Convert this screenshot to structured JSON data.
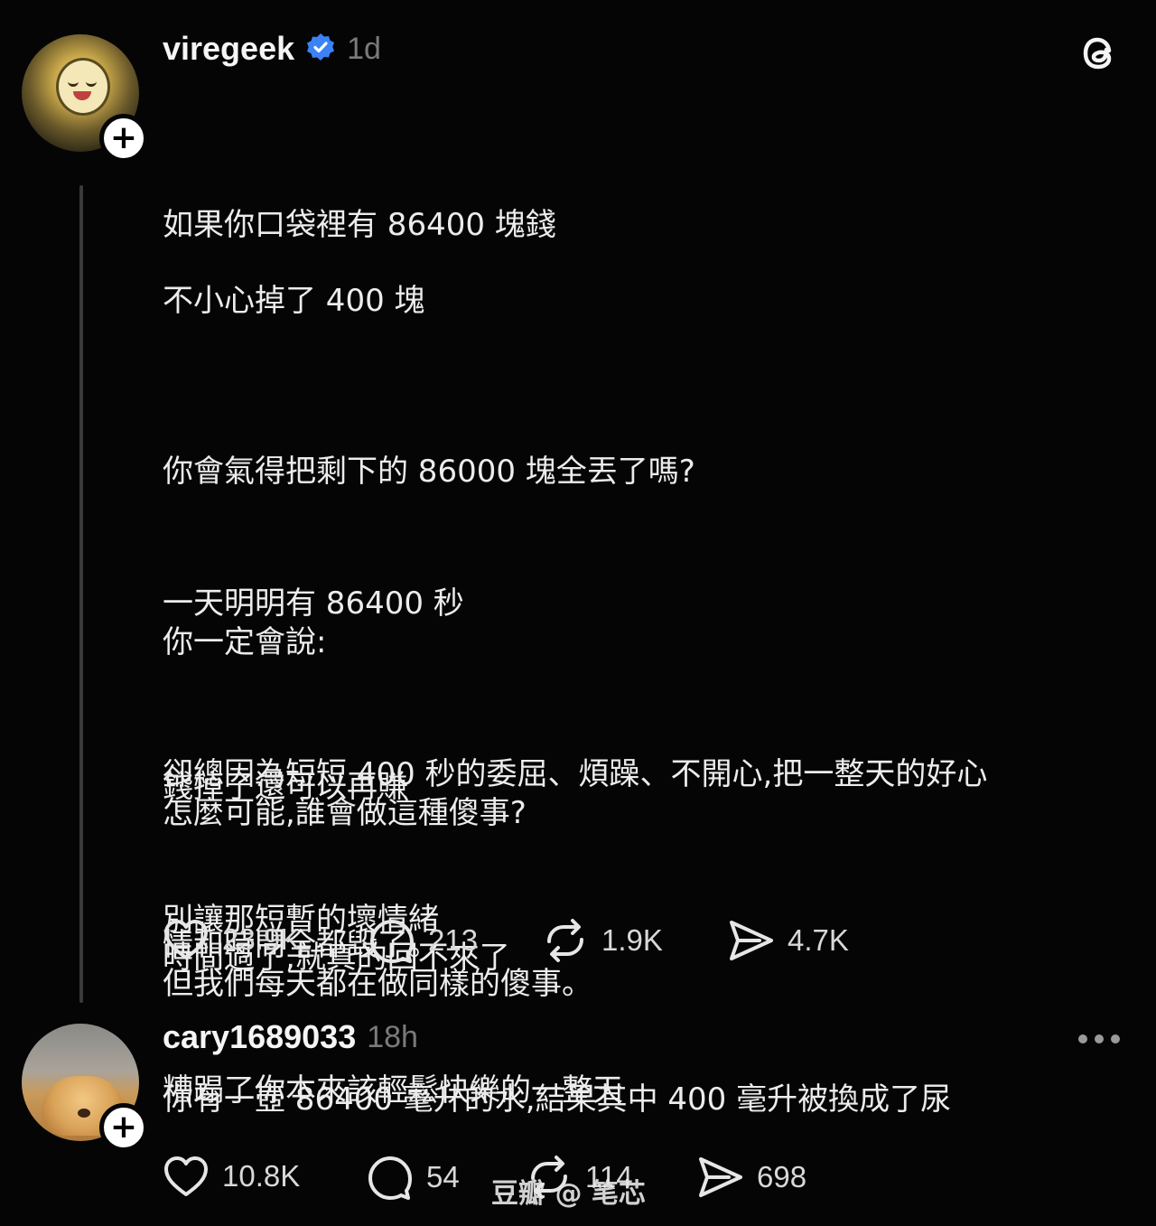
{
  "post": {
    "username": "viregeek",
    "time": "1d",
    "verified": true,
    "paragraphs": [
      [
        "如果你口袋裡有 86400 塊錢"
      ],
      [
        "不小心掉了 400 塊",
        "你會氣得把剩下的 86000 塊全丟了嗎?",
        "你一定會說:",
        "怎麼可能,誰會做這種傻事?",
        "但我們每天都在做同樣的傻事。"
      ],
      [
        "一天明明有 86400 秒",
        "卻總因為短短 400 秒的委屈、煩躁、不開心,把一整天的好心",
        "情和時間全都毀了。"
      ],
      [
        "錢掉了還可以再賺",
        "時間過了,就真的回不來了"
      ],
      [
        "別讓那短暫的壞情緒",
        "糟蹋了你本來該輕鬆快樂的一整天"
      ]
    ],
    "actions": {
      "likes": "23.9K",
      "replies": "213",
      "reposts": "1.9K",
      "shares": "4.7K"
    }
  },
  "reply": {
    "username": "cary1689033",
    "time": "18h",
    "text": "你有一壺 86400 毫升的水,結果其中 400 毫升被換成了尿",
    "actions": {
      "likes": "10.8K",
      "replies": "54",
      "reposts": "114",
      "shares": "698"
    }
  },
  "watermark": "豆瓣 @ 笔芯",
  "icons": {
    "app": "threads-logo-icon",
    "verified": "verified-badge-icon",
    "more": "more-options-icon",
    "like": "heart-icon",
    "reply": "comment-bubble-icon",
    "repost": "repost-icon",
    "share": "send-icon"
  },
  "colors": {
    "background": "#050505",
    "text": "#ececec",
    "muted": "#7a7a7a",
    "verified": "#3b82f6"
  }
}
